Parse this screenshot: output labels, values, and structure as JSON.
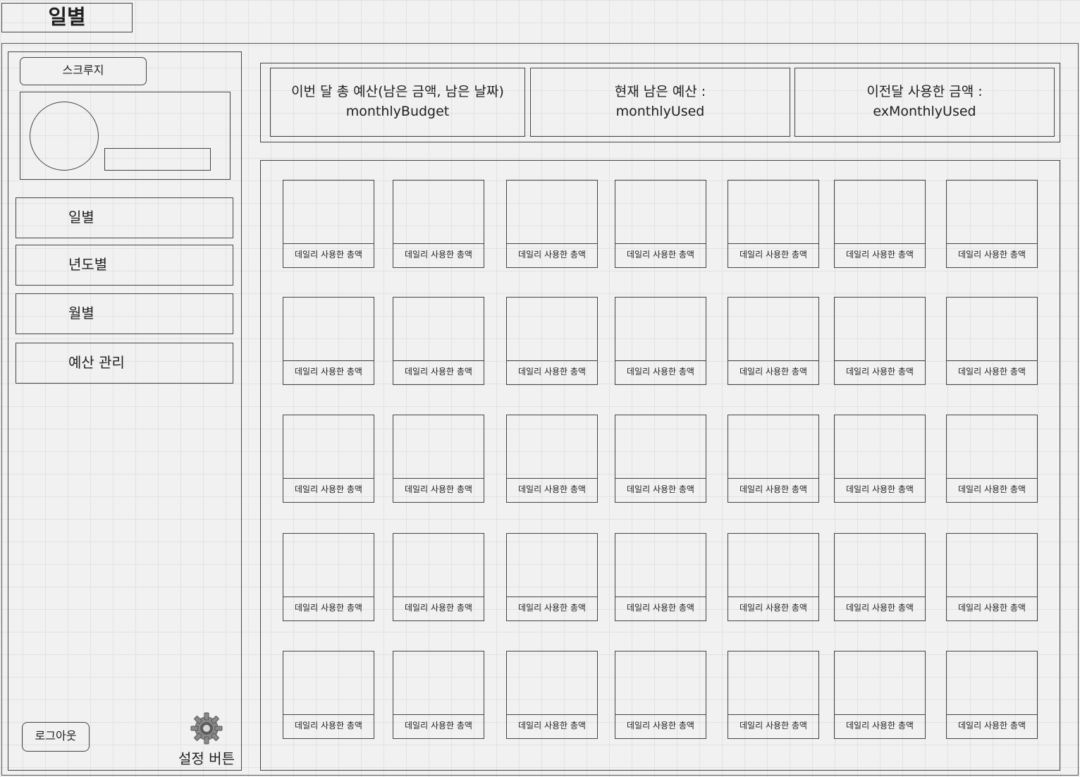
{
  "page": {
    "title": "일별"
  },
  "sidebar": {
    "app_name": "스크루지",
    "nav": [
      {
        "label": "일별"
      },
      {
        "label": "년도별"
      },
      {
        "label": "월별"
      },
      {
        "label": "예산 관리"
      }
    ],
    "logout_label": "로그아웃",
    "settings_label": "설정 버튼",
    "settings_icon": "gear-icon"
  },
  "summary": {
    "budget": {
      "title": "이번 달 총 예산(남은 금액, 남은 날짜)",
      "value": "monthlyBudget"
    },
    "remaining": {
      "title": "현재 남은 예산 :",
      "value": "monthlyUsed"
    },
    "previous": {
      "title": "이전달 사용한 금액 :",
      "value": "exMonthlyUsed"
    }
  },
  "daily_grid": {
    "cell_label": "데일리 사용한 총액",
    "rows": 5,
    "columns": 7
  }
}
